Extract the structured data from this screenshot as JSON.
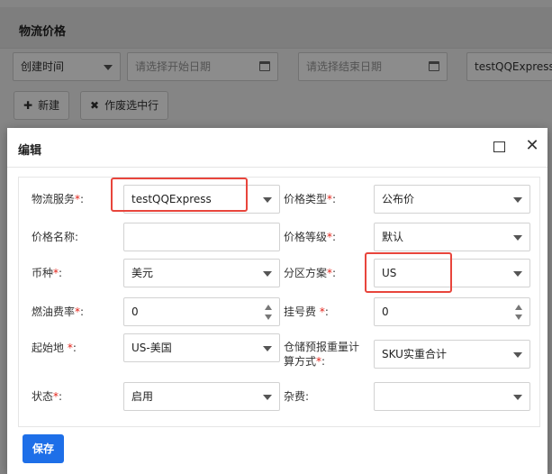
{
  "background": {
    "page_title": "物流价格",
    "filters": {
      "date_type": "创建时间",
      "start_date_placeholder": "请选择开始日期",
      "end_date_placeholder": "请选择结束日期",
      "service_value": "testQQExpress"
    },
    "buttons": {
      "new_label": "新建",
      "new_icon": "✚",
      "void_label": "作废选中行",
      "void_icon": "✖"
    }
  },
  "modal": {
    "title": "编辑",
    "close_glyph": "✕",
    "fields": {
      "logistics_service": {
        "label": "物流服务",
        "req": "*",
        "colon": ":",
        "value": "testQQExpress"
      },
      "price_type": {
        "label": "价格类型",
        "req": "*",
        "colon": ":",
        "value": "公布价"
      },
      "price_name": {
        "label": "价格名称:",
        "value": ""
      },
      "price_level": {
        "label": "价格等级",
        "req": "*",
        "colon": ":",
        "value": "默认"
      },
      "currency": {
        "label": "币种",
        "req": "*",
        "colon": ":",
        "value": "美元"
      },
      "zone_plan": {
        "label": "分区方案",
        "req": "*",
        "colon": ":",
        "value": "US"
      },
      "fuel_rate": {
        "label": "燃油费率",
        "req": "*",
        "colon": ":",
        "value": "0"
      },
      "registration_fee": {
        "label": "挂号费 ",
        "req": "*",
        "colon": ":",
        "value": "0"
      },
      "origin": {
        "label": "起始地 ",
        "req": "*",
        "colon": ":",
        "value": "US-美国"
      },
      "weight_calc": {
        "label_line1": "仓储预报重量计",
        "label_line2": "算方式",
        "req": "*",
        "colon": ":",
        "value": "SKU实重合计"
      },
      "status": {
        "label": "状态",
        "req": "*",
        "colon": ":",
        "value": "启用"
      },
      "misc_fee": {
        "label": "杂费:",
        "value": ""
      }
    },
    "save_label": "保存"
  },
  "colors": {
    "primary": "#1e6fe8",
    "required": "#e2231a",
    "highlight": "#e8453c"
  }
}
